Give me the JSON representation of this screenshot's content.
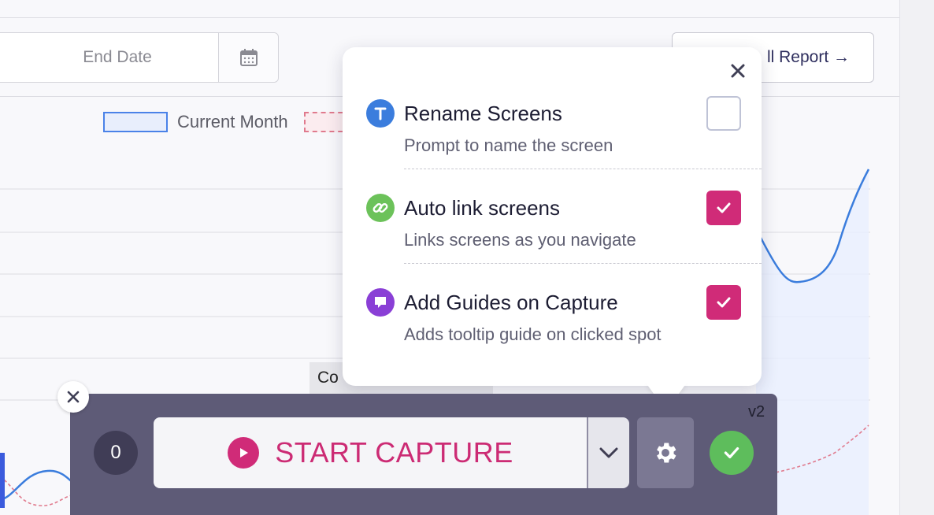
{
  "background": {
    "date_placeholder": "End Date",
    "report_button_label": "ll Report →",
    "legend": {
      "current_month": "Current Month"
    },
    "tooltip_text": "Co"
  },
  "settings_popover": {
    "options": [
      {
        "title": "Rename Screens",
        "description": "Prompt to name the screen",
        "checked": false,
        "icon": "text-t-icon",
        "icon_color": "#3b7ddd"
      },
      {
        "title": "Auto link screens",
        "description": "Links screens as you navigate",
        "checked": true,
        "icon": "link-icon",
        "icon_color": "#6cc25a"
      },
      {
        "title": "Add Guides on Capture",
        "description": "Adds tooltip guide on clicked spot",
        "checked": true,
        "icon": "chat-bubble-icon",
        "icon_color": "#8a3fd6"
      }
    ]
  },
  "toolbar": {
    "count": "0",
    "capture_label": "START CAPTURE",
    "version": "v2"
  },
  "colors": {
    "accent": "#d02b78",
    "toolbar_bg": "#5e5b77",
    "success": "#5ebd5c",
    "line_blue": "#3b7ddd",
    "line_pink": "#e07a8d"
  }
}
